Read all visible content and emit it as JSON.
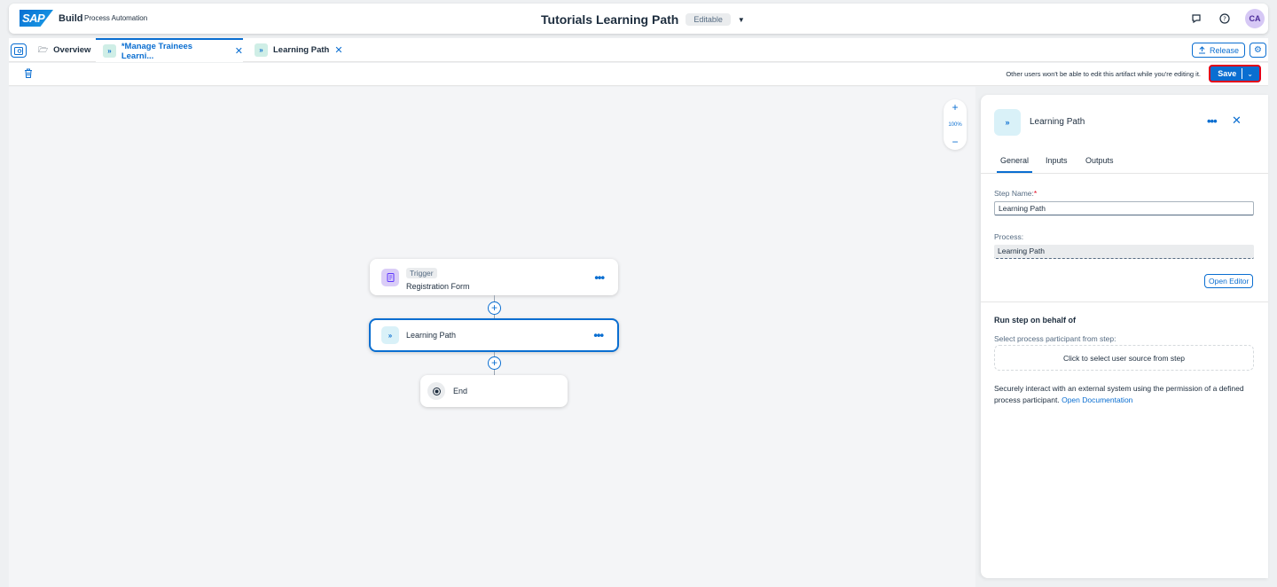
{
  "shell": {
    "logo_text": "SAP",
    "brand": "Build",
    "product": "Process Automation",
    "title": "Tutorials Learning Path",
    "mode_badge": "Editable",
    "avatar_initials": "CA"
  },
  "tabs": {
    "overview": "Overview",
    "active_tab": "*Manage Trainees Learni...",
    "second_tab": "Learning Path",
    "release": "Release"
  },
  "toolbar": {
    "notice": "Other users won't be able to edit this artifact while you're editing it.",
    "save": "Save"
  },
  "canvas": {
    "zoom_level": "100%",
    "trigger_tag": "Trigger",
    "trigger_name": "Registration Form",
    "step_name": "Learning Path",
    "end_label": "End"
  },
  "panel": {
    "title": "Learning Path",
    "tabs": [
      "General",
      "Inputs",
      "Outputs"
    ],
    "step_name_label": "Step Name:",
    "step_name_required": "*",
    "step_name_value": "Learning Path",
    "process_label": "Process:",
    "process_value": "Learning Path",
    "open_editor": "Open Editor",
    "run_on_behalf_title": "Run step on behalf of",
    "select_participant_label": "Select process participant from step:",
    "select_user_source": "Click to select user source from step",
    "description": "Securely interact with an external system using the permission of a defined process participant.",
    "doc_link": "Open Documentation"
  },
  "colors": {
    "accent": "#0a6ed1",
    "highlight_border": "#e1001a",
    "canvas_bg": "#f4f5f7"
  }
}
